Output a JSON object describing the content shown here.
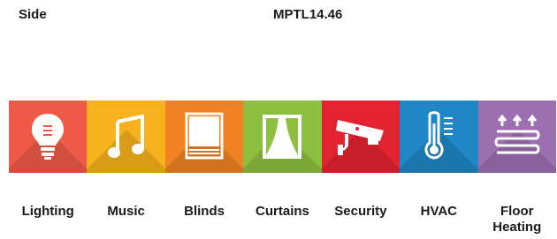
{
  "header": {
    "side_label": "Side",
    "model_label": "MPTL14.46"
  },
  "tiles": [
    {
      "label": "Lighting",
      "icon": "lightbulb-icon",
      "color": "#ef5a48"
    },
    {
      "label": "Music",
      "icon": "music-note-icon",
      "color": "#f7b21d"
    },
    {
      "label": "Blinds",
      "icon": "blinds-icon",
      "color": "#f08223"
    },
    {
      "label": "Curtains",
      "icon": "curtains-icon",
      "color": "#8dc03f"
    },
    {
      "label": "Security",
      "icon": "security-camera-icon",
      "color": "#e32330"
    },
    {
      "label": "HVAC",
      "icon": "thermometer-icon",
      "color": "#1f87c6"
    },
    {
      "label": "Floor\nHeating",
      "icon": "floor-heating-icon",
      "color": "#9c6fb1"
    }
  ]
}
